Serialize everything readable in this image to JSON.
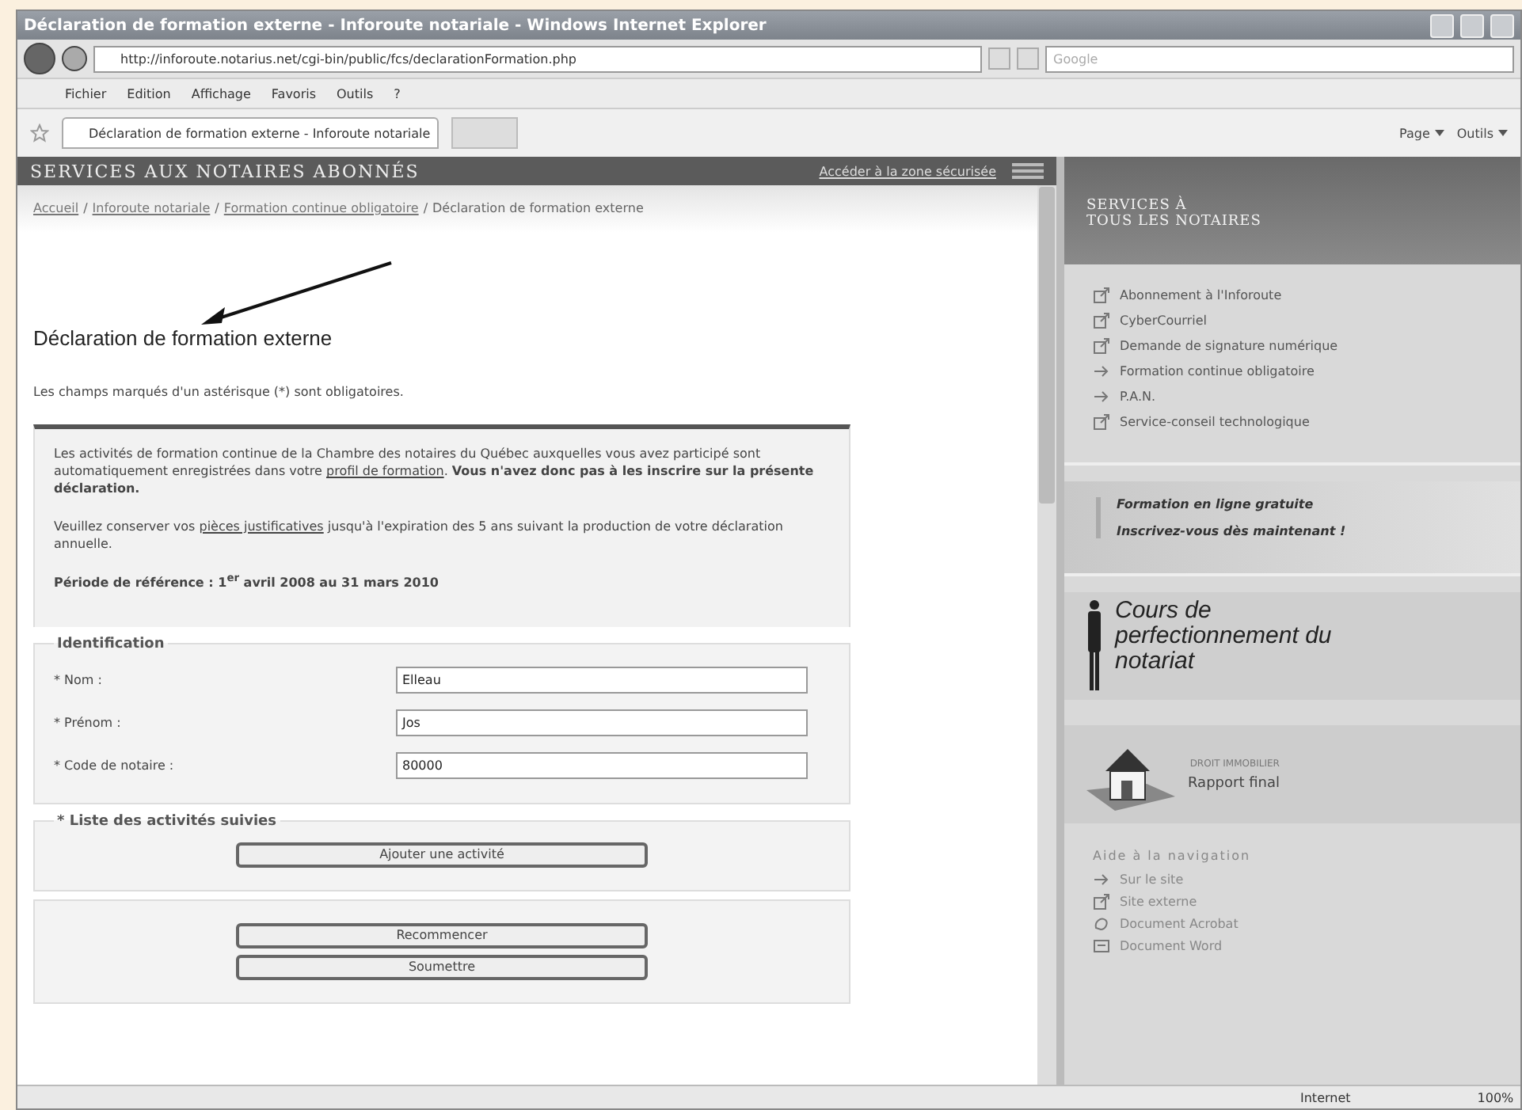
{
  "window": {
    "title": "Déclaration de formation externe - Inforoute notariale - Windows Internet Explorer"
  },
  "address_bar": {
    "url": "http://inforoute.notarius.net/cgi-bin/public/fcs/declarationFormation.php",
    "search_placeholder": "Google"
  },
  "menu": [
    "Fichier",
    "Edition",
    "Affichage",
    "Favoris",
    "Outils",
    "?"
  ],
  "tabs": [
    {
      "label": "Déclaration de formation externe - Inforoute notariale",
      "selected": true
    }
  ],
  "command_bar": [
    "Page",
    "Outils"
  ],
  "site_header": {
    "title": "SERVICES AUX NOTAIRES ABONNÉS",
    "link": "Accéder à la zone sécurisée"
  },
  "breadcrumb": {
    "separator": "/",
    "items": [
      {
        "text": "Accueil",
        "kind": "link"
      },
      {
        "text": "Inforoute notariale",
        "kind": "link"
      },
      {
        "text": "Formation continue obligatoire",
        "kind": "link"
      },
      {
        "text": "Déclaration de formation externe",
        "kind": "current"
      }
    ]
  },
  "heading": "Déclaration de formation externe",
  "required_note": "Les champs marqués d'un astérisque (*) sont obligatoires.",
  "info": {
    "paragraphs": [
      [
        {
          "kind": "text",
          "text": "Les activités de formation continue de la Chambre des notaires du Québec auxquelles vous avez participé sont automatiquement enregistrées dans votre "
        },
        {
          "kind": "link",
          "text": "profil de formation"
        },
        {
          "kind": "text",
          "text": ". "
        },
        {
          "kind": "bold",
          "text": "Vous n'avez donc pas à les inscrire sur la présente déclaration."
        }
      ],
      [
        {
          "kind": "text",
          "text": "Veuillez conserver vos "
        },
        {
          "kind": "link",
          "text": "pièces justificatives"
        },
        {
          "kind": "text",
          "text": " jusqu'à l'expiration des 5 ans suivant la production de votre déclaration annuelle."
        }
      ]
    ],
    "period": "Période de référence : 1$^{er}$ avril 2008 au 31 mars 2010"
  },
  "identification": {
    "legend": "Identification",
    "fields": [
      {
        "label": "* Nom :",
        "value": "Elleau"
      },
      {
        "label": "* Prénom :",
        "value": "Jos"
      },
      {
        "label": "* Code de notaire :",
        "value": "80000"
      }
    ]
  },
  "activities": {
    "legend": "* Liste des activités suivies",
    "button": "Ajouter une activité"
  },
  "buttons": [
    "Recommencer",
    "Soumettre"
  ],
  "sidebar": {
    "title_lines": [
      "SERVICES À",
      "TOUS LES NOTAIRES"
    ],
    "links": [
      {
        "text": "Abonnement à l'Inforoute",
        "kind": "external"
      },
      {
        "text": "CyberCourriel",
        "kind": "external"
      },
      {
        "text": "Demande de signature numérique",
        "kind": "external"
      },
      {
        "text": "Formation continue obligatoire",
        "kind": "internal"
      },
      {
        "text": "P.A.N.",
        "kind": "internal"
      },
      {
        "text": "Service-conseil technologique",
        "kind": "external"
      }
    ],
    "promo": {
      "title": "Formation en ligne gratuite",
      "text": "Inscrivez-vous dès maintenant !"
    },
    "course": "Cours de perfectionnement du notariat",
    "report": {
      "org": "DROIT IMMOBILIER",
      "link": "Rapport final"
    },
    "nav_help": {
      "title": "Aide à la navigation",
      "items": [
        {
          "text": "Sur le site",
          "kind": "internal"
        },
        {
          "text": "Site externe",
          "kind": "external"
        },
        {
          "text": "Document Acrobat",
          "kind": "pdf"
        },
        {
          "text": "Document Word",
          "kind": "word"
        }
      ]
    }
  },
  "status_bar": {
    "zone": "Internet",
    "zoom": "100%"
  }
}
